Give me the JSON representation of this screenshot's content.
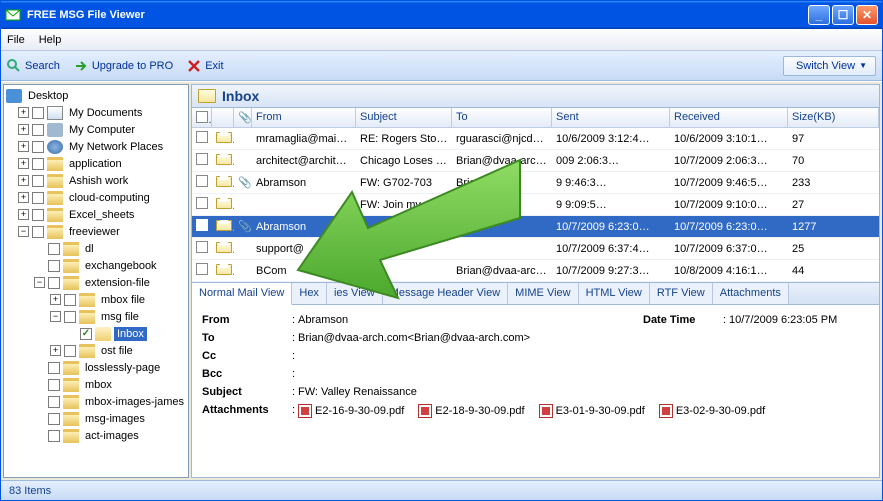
{
  "window": {
    "title": "FREE MSG File Viewer"
  },
  "menu": {
    "file": "File",
    "help": "Help"
  },
  "toolbar": {
    "search": "Search",
    "upgrade": "Upgrade to PRO",
    "exit": "Exit",
    "switch": "Switch View"
  },
  "tree": {
    "root": "Desktop",
    "mydocs": "My Documents",
    "mycomp": "My Computer",
    "mynet": "My Network Places",
    "items": [
      "application",
      "Ashish work",
      "cloud-computing",
      "Excel_sheets",
      "freeviewer",
      "dl",
      "exchangebook",
      "extension-file",
      "mbox file",
      "msg file",
      "Inbox",
      "ost file",
      "losslessly-page",
      "mbox",
      "mbox-images-james",
      "msg-images",
      "act-images"
    ]
  },
  "inbox": {
    "title": "Inbox"
  },
  "columns": {
    "from": "From",
    "subject": "Subject",
    "to": "To",
    "sent": "Sent",
    "received": "Received",
    "size": "Size(KB)"
  },
  "rows": [
    {
      "from": "mramaglia@mai…",
      "subject": "RE: Rogers Stor…",
      "to": "rguarasci@njcd…",
      "sent": "10/6/2009 3:12:4…",
      "received": "10/6/2009 3:10:1…",
      "size": "97",
      "att": false
    },
    {
      "from": "architect@archit…",
      "subject": "Chicago Loses 2…",
      "to": "Brian@dvaa-arc…",
      "sent": "009 2:06:3…",
      "received": "10/7/2009 2:06:3…",
      "size": "70",
      "att": false
    },
    {
      "from": "Abramson",
      "subject": "FW: G702-703",
      "to": "Brian@",
      "sent": "9 9:46:3…",
      "received": "10/7/2009 9:46:5…",
      "size": "233",
      "att": true
    },
    {
      "from": "",
      "subject": "FW: Join my n",
      "to": "",
      "sent": "9 9:09:5…",
      "received": "10/7/2009 9:10:0…",
      "size": "27",
      "att": false
    },
    {
      "from": "Abramson",
      "subject": "",
      "to": "rc…",
      "sent": "10/7/2009 6:23:0…",
      "received": "10/7/2009 6:23:0…",
      "size": "1277",
      "att": true,
      "sel": true
    },
    {
      "from": "support@",
      "subject": "",
      "to": "",
      "sent": "10/7/2009 6:37:4…",
      "received": "10/7/2009 6:37:0…",
      "size": "25",
      "att": false
    },
    {
      "from": "BCom",
      "subject": "",
      "to": "Brian@dvaa-arc…",
      "sent": "10/7/2009 9:27:3…",
      "received": "10/8/2009 4:16:1…",
      "size": "44",
      "att": false
    }
  ],
  "tabs": {
    "normal": "Normal Mail View",
    "hex": "Hex",
    "prop": "ies View",
    "header": "Message Header View",
    "mime": "MIME View",
    "html": "HTML View",
    "rtf": "RTF View",
    "attach": "Attachments"
  },
  "detail": {
    "from_lbl": "From",
    "from": "Abramson",
    "dt_lbl": "Date Time",
    "dt": "10/7/2009 6:23:05 PM",
    "to_lbl": "To",
    "to": "Brian@dvaa-arch.com<Brian@dvaa-arch.com>",
    "cc_lbl": "Cc",
    "cc": "",
    "bcc_lbl": "Bcc",
    "bcc": "",
    "subj_lbl": "Subject",
    "subj": "FW: Valley Renaissance",
    "att_lbl": "Attachments",
    "atts": [
      "E2-16-9-30-09.pdf",
      "E2-18-9-30-09.pdf",
      "E3-01-9-30-09.pdf",
      "E3-02-9-30-09.pdf"
    ]
  },
  "status": {
    "text": "83 Items"
  }
}
